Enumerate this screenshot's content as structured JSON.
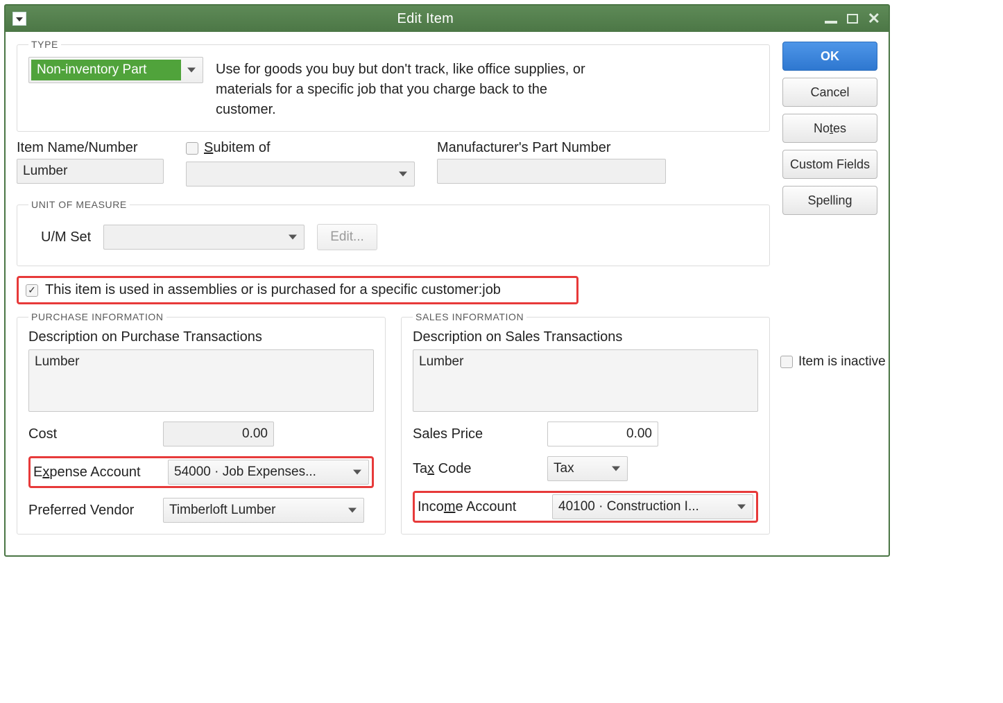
{
  "window": {
    "title": "Edit Item"
  },
  "buttons": {
    "ok": "OK",
    "cancel": "Cancel",
    "notes": "Notes",
    "custom_fields": "Custom Fields",
    "spelling": "Spelling"
  },
  "type": {
    "legend": "TYPE",
    "selected": "Non-inventory Part",
    "description": "Use for goods you buy but don't track, like office supplies, or materials for a specific job that you charge back to the customer."
  },
  "item": {
    "name_label": "Item Name/Number",
    "name_value": "Lumber",
    "subitem_label": "Subitem of",
    "subitem_value": "",
    "mpn_label": "Manufacturer's Part Number",
    "mpn_value": ""
  },
  "uom": {
    "legend": "UNIT OF MEASURE",
    "set_label": "U/M Set",
    "set_value": "",
    "edit_label": "Edit..."
  },
  "assembly": {
    "checked": "✓",
    "label": "This item is used in assemblies or is purchased for a specific customer:job"
  },
  "purchase": {
    "legend": "PURCHASE INFORMATION",
    "desc_label": "Description on Purchase Transactions",
    "desc_value": "Lumber",
    "cost_label": "Cost",
    "cost_value": "0.00",
    "expense_label": "Expense Account",
    "expense_value": "54000 · Job Expenses...",
    "vendor_label": "Preferred Vendor",
    "vendor_value": "Timberloft Lumber"
  },
  "sales": {
    "legend": "SALES INFORMATION",
    "desc_label": "Description on Sales Transactions",
    "desc_value": "Lumber",
    "price_label": "Sales Price",
    "price_value": "0.00",
    "tax_label": "Tax Code",
    "tax_value": "Tax",
    "income_label": "Income Account",
    "income_value": "40100 · Construction I..."
  },
  "inactive": {
    "label": "Item is inactive"
  }
}
